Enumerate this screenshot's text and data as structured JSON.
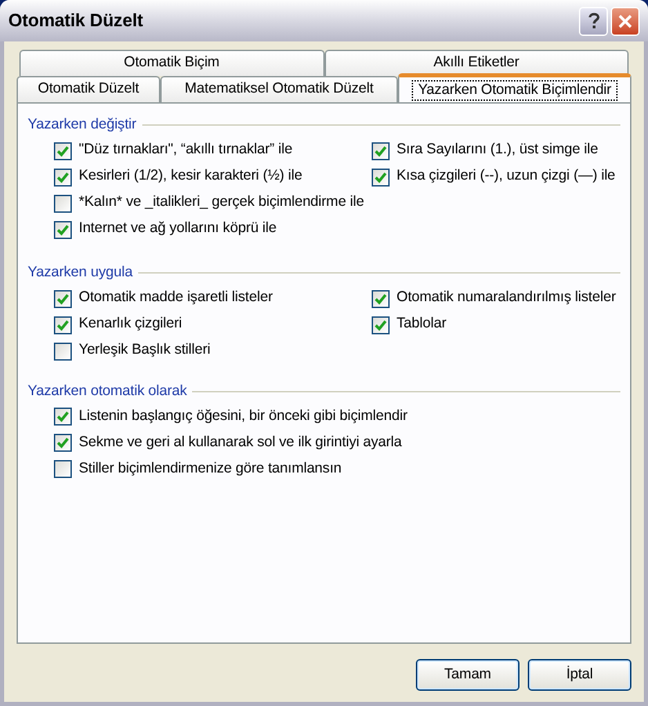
{
  "window": {
    "title": "Otomatik Düzelt"
  },
  "tab_rows": [
    [
      {
        "label": "Otomatik Biçim",
        "selected": false
      },
      {
        "label": "Akıllı Etiketler",
        "selected": false
      }
    ],
    [
      {
        "label": "Otomatik Düzelt",
        "selected": false
      },
      {
        "label": "Matematiksel Otomatik Düzelt",
        "selected": false
      },
      {
        "label": "Yazarken Otomatik Biçimlendir",
        "selected": true
      }
    ]
  ],
  "sections": [
    {
      "title": "Yazarken değiştir",
      "left": [
        {
          "label": "\"Düz tırnakları\", “akıllı tırnaklar” ile",
          "checked": true
        },
        {
          "label": "Kesirleri (1/2), kesir karakteri (½) ile",
          "checked": true
        },
        {
          "label": "*Kalın* ve _italikleri_ gerçek biçimlendirme ile",
          "checked": false
        },
        {
          "label": "Internet ve ağ yollarını köprü ile",
          "checked": true
        }
      ],
      "right": [
        {
          "label": "Sıra Sayılarını (1.), üst simge ile",
          "checked": true
        },
        {
          "label": "Kısa çizgileri (--), uzun çizgi (—) ile",
          "checked": true
        }
      ]
    },
    {
      "title": "Yazarken uygula",
      "left": [
        {
          "label": "Otomatik madde işaretli listeler",
          "checked": true
        },
        {
          "label": "Kenarlık çizgileri",
          "checked": true
        },
        {
          "label": "Yerleşik Başlık stilleri",
          "checked": false
        }
      ],
      "right": [
        {
          "label": "Otomatik numaralandırılmış listeler",
          "checked": true
        },
        {
          "label": "Tablolar",
          "checked": true
        }
      ]
    },
    {
      "title": "Yazarken otomatik olarak",
      "left": [
        {
          "label": "Listenin başlangıç öğesini, bir önceki gibi biçimlendir",
          "checked": true
        },
        {
          "label": "Sekme ve geri al kullanarak sol ve ilk girintiyi ayarla",
          "checked": true
        },
        {
          "label": "Stiller biçimlendirmenize göre tanımlansın",
          "checked": false
        }
      ]
    }
  ],
  "buttons": [
    "Tamam",
    "İptal"
  ]
}
